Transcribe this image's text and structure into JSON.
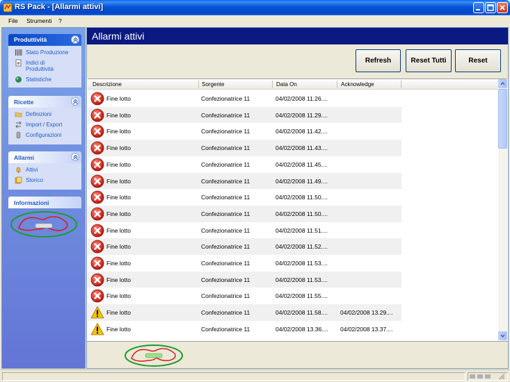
{
  "window": {
    "title": "RS Pack - [Allarmi attivi]",
    "icon": "app-icon"
  },
  "menu": {
    "items": [
      "File",
      "Strumenti",
      "?"
    ]
  },
  "sidebar": {
    "groups": [
      {
        "title": "Produttività",
        "items": [
          {
            "label": "Stato Produzione",
            "icon": "bars-icon"
          },
          {
            "label": "Indici di Produttività",
            "icon": "document-icon"
          },
          {
            "label": "Statistiche",
            "icon": "globe-icon"
          }
        ]
      },
      {
        "title": "Ricette",
        "items": [
          {
            "label": "Definizioni",
            "icon": "folder-icon"
          },
          {
            "label": "Import / Export",
            "icon": "arrows-icon"
          },
          {
            "label": "Configurazioni",
            "icon": "cylinder-icon"
          }
        ]
      },
      {
        "title": "Allarmi",
        "items": [
          {
            "label": "Attivi",
            "icon": "alarm-bell-icon"
          },
          {
            "label": "Storico",
            "icon": "history-icon"
          }
        ]
      }
    ],
    "info_title": "Informazioni"
  },
  "page": {
    "title": "Allarmi attivi"
  },
  "toolbar": {
    "refresh_label": "Refresh",
    "reset_all_label": "Reset Tutti",
    "reset_label": "Reset"
  },
  "grid": {
    "columns": [
      "Descrizione",
      "Sorgente",
      "Data On",
      "Acknowledge"
    ],
    "rows": [
      {
        "type": "error",
        "descrizione": "Fine lotto",
        "sorgente": "Confezionatrice 11",
        "data_on": "04/02/2008 11.26....",
        "acknowledge": ""
      },
      {
        "type": "error",
        "descrizione": "Fine lotto",
        "sorgente": "Confezionatrice 11",
        "data_on": "04/02/2008 11.29....",
        "acknowledge": ""
      },
      {
        "type": "error",
        "descrizione": "Fine lotto",
        "sorgente": "Confezionatrice 11",
        "data_on": "04/02/2008 11.42....",
        "acknowledge": ""
      },
      {
        "type": "error",
        "descrizione": "Fine lotto",
        "sorgente": "Confezionatrice 11",
        "data_on": "04/02/2008 11.43....",
        "acknowledge": ""
      },
      {
        "type": "error",
        "descrizione": "Fine lotto",
        "sorgente": "Confezionatrice 11",
        "data_on": "04/02/2008 11.45....",
        "acknowledge": ""
      },
      {
        "type": "error",
        "descrizione": "Fine lotto",
        "sorgente": "Confezionatrice 11",
        "data_on": "04/02/2008 11.49....",
        "acknowledge": ""
      },
      {
        "type": "error",
        "descrizione": "Fine lotto",
        "sorgente": "Confezionatrice 11",
        "data_on": "04/02/2008 11.50....",
        "acknowledge": ""
      },
      {
        "type": "error",
        "descrizione": "Fine lotto",
        "sorgente": "Confezionatrice 11",
        "data_on": "04/02/2008 11.50....",
        "acknowledge": ""
      },
      {
        "type": "error",
        "descrizione": "Fine lotto",
        "sorgente": "Confezionatrice 11",
        "data_on": "04/02/2008 11.51....",
        "acknowledge": ""
      },
      {
        "type": "error",
        "descrizione": "Fine lotto",
        "sorgente": "Confezionatrice 11",
        "data_on": "04/02/2008 11.52....",
        "acknowledge": ""
      },
      {
        "type": "error",
        "descrizione": "Fine lotto",
        "sorgente": "Confezionatrice 11",
        "data_on": "04/02/2008 11.53....",
        "acknowledge": ""
      },
      {
        "type": "error",
        "descrizione": "Fine lotto",
        "sorgente": "Confezionatrice 11",
        "data_on": "04/02/2008 11.53....",
        "acknowledge": ""
      },
      {
        "type": "error",
        "descrizione": "Fine lotto",
        "sorgente": "Confezionatrice 11",
        "data_on": "04/02/2008 11.55....",
        "acknowledge": ""
      },
      {
        "type": "warning",
        "descrizione": "Fine lotto",
        "sorgente": "Confezionatrice 11",
        "data_on": "04/02/2008 11.58....",
        "acknowledge": "04/02/2008 13.29...."
      },
      {
        "type": "warning",
        "descrizione": "Fine lotto",
        "sorgente": "Confezionatrice 11",
        "data_on": "04/02/2008 13.36....",
        "acknowledge": "04/02/2008 13.37...."
      }
    ]
  },
  "colors": {
    "title_bar": "#0753d8",
    "page_header": "#0a1a82",
    "sidebar_gradient_top": "#7ba2e7",
    "sidebar_gradient_bottom": "#6375d6",
    "error_red": "#e0302a",
    "warning_yellow": "#f5c400",
    "annotation_green": "#1f9a2d",
    "annotation_red": "#d42020"
  }
}
